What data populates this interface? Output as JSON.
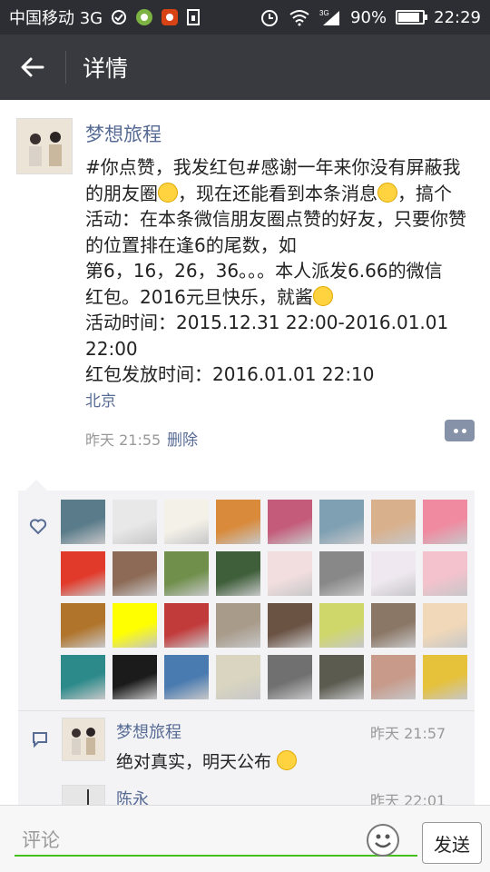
{
  "status_bar": {
    "carrier": "中国移动 3G",
    "battery": "90%",
    "battery_level": 0.9,
    "network_label": "3G",
    "time": "22:29"
  },
  "header": {
    "title": "详情"
  },
  "post": {
    "author": "梦想旅程",
    "text_lines": [
      "#你点赞，我发红包#感谢一年来你没有屏蔽我",
      "的朋友圈",
      "，现在还能看到本条消息",
      "，搞个活动：在本条微信朋友圈点赞的好友，只要你赞的位置排在逢6的尾数，如",
      "第6，16，26，36。。。本人派发6.66的微信",
      "红包。2016元旦快乐，就酱",
      "活动时间：2015.12.31 22:00-2016.01.01",
      "22:00",
      "红包发放时间：2016.01.01 22:10"
    ],
    "location": "北京",
    "time": "昨天 21:55",
    "delete_label": "删除"
  },
  "likes": {
    "count": 32
  },
  "comments": [
    {
      "author": "梦想旅程",
      "time": "昨天 21:57",
      "text": "绝对真实，明天公布"
    },
    {
      "author": "陈永",
      "time": "昨天 22:01",
      "text": ""
    }
  ],
  "input": {
    "placeholder": "评论",
    "send_label": "发送"
  },
  "colors": {
    "header_bg": "#393a3f",
    "status_bg": "#2c2e33",
    "link": "#576b95",
    "accent_green": "#45c01a"
  }
}
